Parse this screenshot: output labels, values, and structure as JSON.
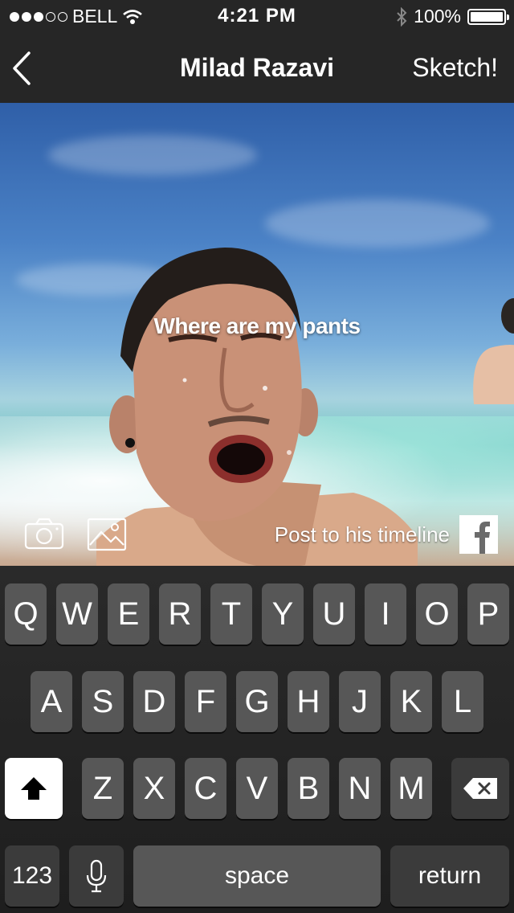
{
  "status_bar": {
    "carrier": "BELL",
    "time": "4:21 PM",
    "battery": "100%",
    "signal_bars_filled": 3,
    "signal_bars_total": 5
  },
  "nav": {
    "title": "Milad Razavi",
    "back_icon": "chevron-left-icon",
    "action_label": "Sketch!"
  },
  "photo": {
    "caption": "Where are my pants",
    "post_label": "Post to his timeline",
    "icons": [
      "camera-icon",
      "image-icon",
      "facebook-icon"
    ]
  },
  "keyboard": {
    "row1": [
      "Q",
      "W",
      "E",
      "R",
      "T",
      "Y",
      "U",
      "I",
      "O",
      "P"
    ],
    "row2": [
      "A",
      "S",
      "D",
      "F",
      "G",
      "H",
      "J",
      "K",
      "L"
    ],
    "row3": [
      "Z",
      "X",
      "C",
      "V",
      "B",
      "N",
      "M"
    ],
    "numbers_label": "123",
    "space_label": "space",
    "return_label": "return",
    "icons": [
      "shift-icon",
      "delete-icon",
      "microphone-icon"
    ]
  }
}
